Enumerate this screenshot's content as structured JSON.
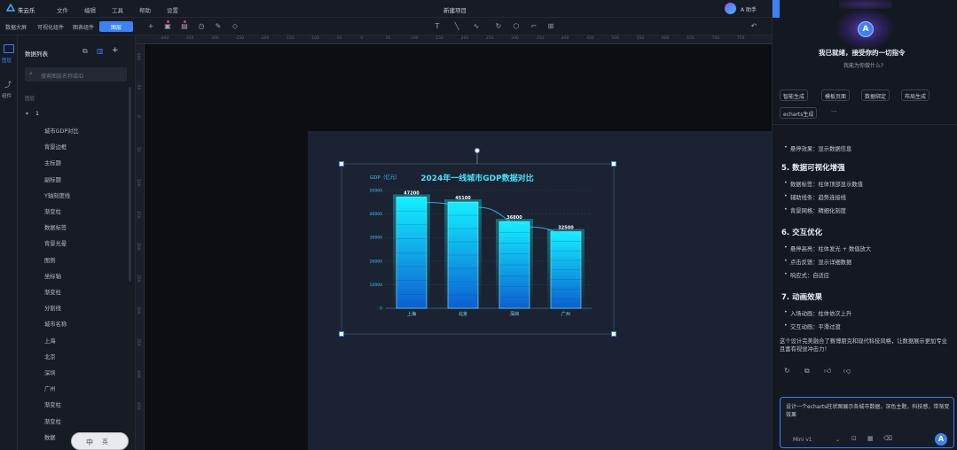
{
  "app": {
    "name": "朱云乐",
    "project_title": "新建项目",
    "user": "A 助手"
  },
  "menu": [
    "文件",
    "编辑",
    "工具",
    "帮助",
    "设置"
  ],
  "tabs": [
    {
      "label": "数据大屏"
    },
    {
      "label": "可视化组件"
    },
    {
      "label": "图表组件"
    },
    {
      "label": "图层",
      "active": true
    }
  ],
  "layers_panel": {
    "title": "数据列表",
    "search_placeholder": "搜索图层名称或ID",
    "group_header": "图层",
    "group_name": "1",
    "items": [
      "城市GDP对比",
      "背景边框",
      "主标题",
      "副标题",
      "Y轴刻度线",
      "渐变柱",
      "数据标签",
      "背景光晕",
      "图例",
      "坐标轴",
      "渐变柱",
      "分割线",
      "城市名称",
      "上海",
      "北京",
      "深圳",
      "广州",
      "渐变柱",
      "渐变柱",
      "数据"
    ],
    "rail": [
      {
        "label": "图层"
      },
      {
        "label": "组件"
      }
    ]
  },
  "ruler_ticks": [
    "-400",
    "-350",
    "-300",
    "-250",
    "-200",
    "-150",
    "-100",
    "-50",
    "0",
    "50",
    "100",
    "150",
    "200",
    "250",
    "300",
    "350",
    "400",
    "450",
    "500",
    "550",
    "600",
    "650",
    "700",
    "750"
  ],
  "ruler_v_ticks": [
    "-100",
    "-50",
    "0",
    "50",
    "100",
    "150",
    "200",
    "250",
    "300",
    "350",
    "400",
    "450"
  ],
  "chart_data": {
    "type": "bar",
    "title": "2024年一线城市GDP数据对比",
    "ylabel": "GDP（亿元）",
    "categories": [
      "上海",
      "北京",
      "深圳",
      "广州"
    ],
    "values": [
      47200,
      45100,
      36800,
      32500
    ],
    "value_labels": [
      "47200",
      "45100",
      "36800",
      "32500"
    ],
    "ylim": [
      0,
      50000
    ],
    "yticks": [
      "0",
      "10000",
      "20000",
      "30000",
      "40000",
      "50000"
    ],
    "grid": true,
    "trend_line": true,
    "colors": {
      "bar_top": "#13f0ff",
      "bar_bottom": "#0c5fd0",
      "title": "#4ae3ff",
      "line": "#3ec8ff"
    }
  },
  "right_panel": {
    "welcome_title": "我已就绪，接受你的一切指令",
    "welcome_sub": "我能为你做什么?",
    "chips": [
      "智能生成",
      "模板页面",
      "数据绑定",
      "布局生成",
      "echarts生成"
    ],
    "more": "···",
    "intro_bullet": "悬停效果：显示数据信息",
    "sections": [
      {
        "title": "5. 数据可视化增强",
        "bullets": [
          "数据标签：柱体顶部显示数值",
          "辅助线条：趋势连接线",
          "背景网格：精细化刻度"
        ]
      },
      {
        "title": "6. 交互优化",
        "bullets": [
          "悬停高亮：柱体发光 + 数值放大",
          "点击反馈：显示详细数据",
          "响应式：自适应"
        ]
      },
      {
        "title": "7. 动画效果",
        "bullets": [
          "入场动画：柱体依次上升",
          "交互动画：平滑过渡"
        ]
      }
    ],
    "summary": "这个设计完美融合了赛博朋克和现代科技风格，让数据展示更加专业且富有视觉冲击力！",
    "input_text": "设计一个echarts柱状图展示各城市数据，深色主题，科技感，带渐变效果",
    "model": "Mini v1",
    "send_label": "发送"
  },
  "ime": {
    "label": "中",
    "label2": "英"
  }
}
